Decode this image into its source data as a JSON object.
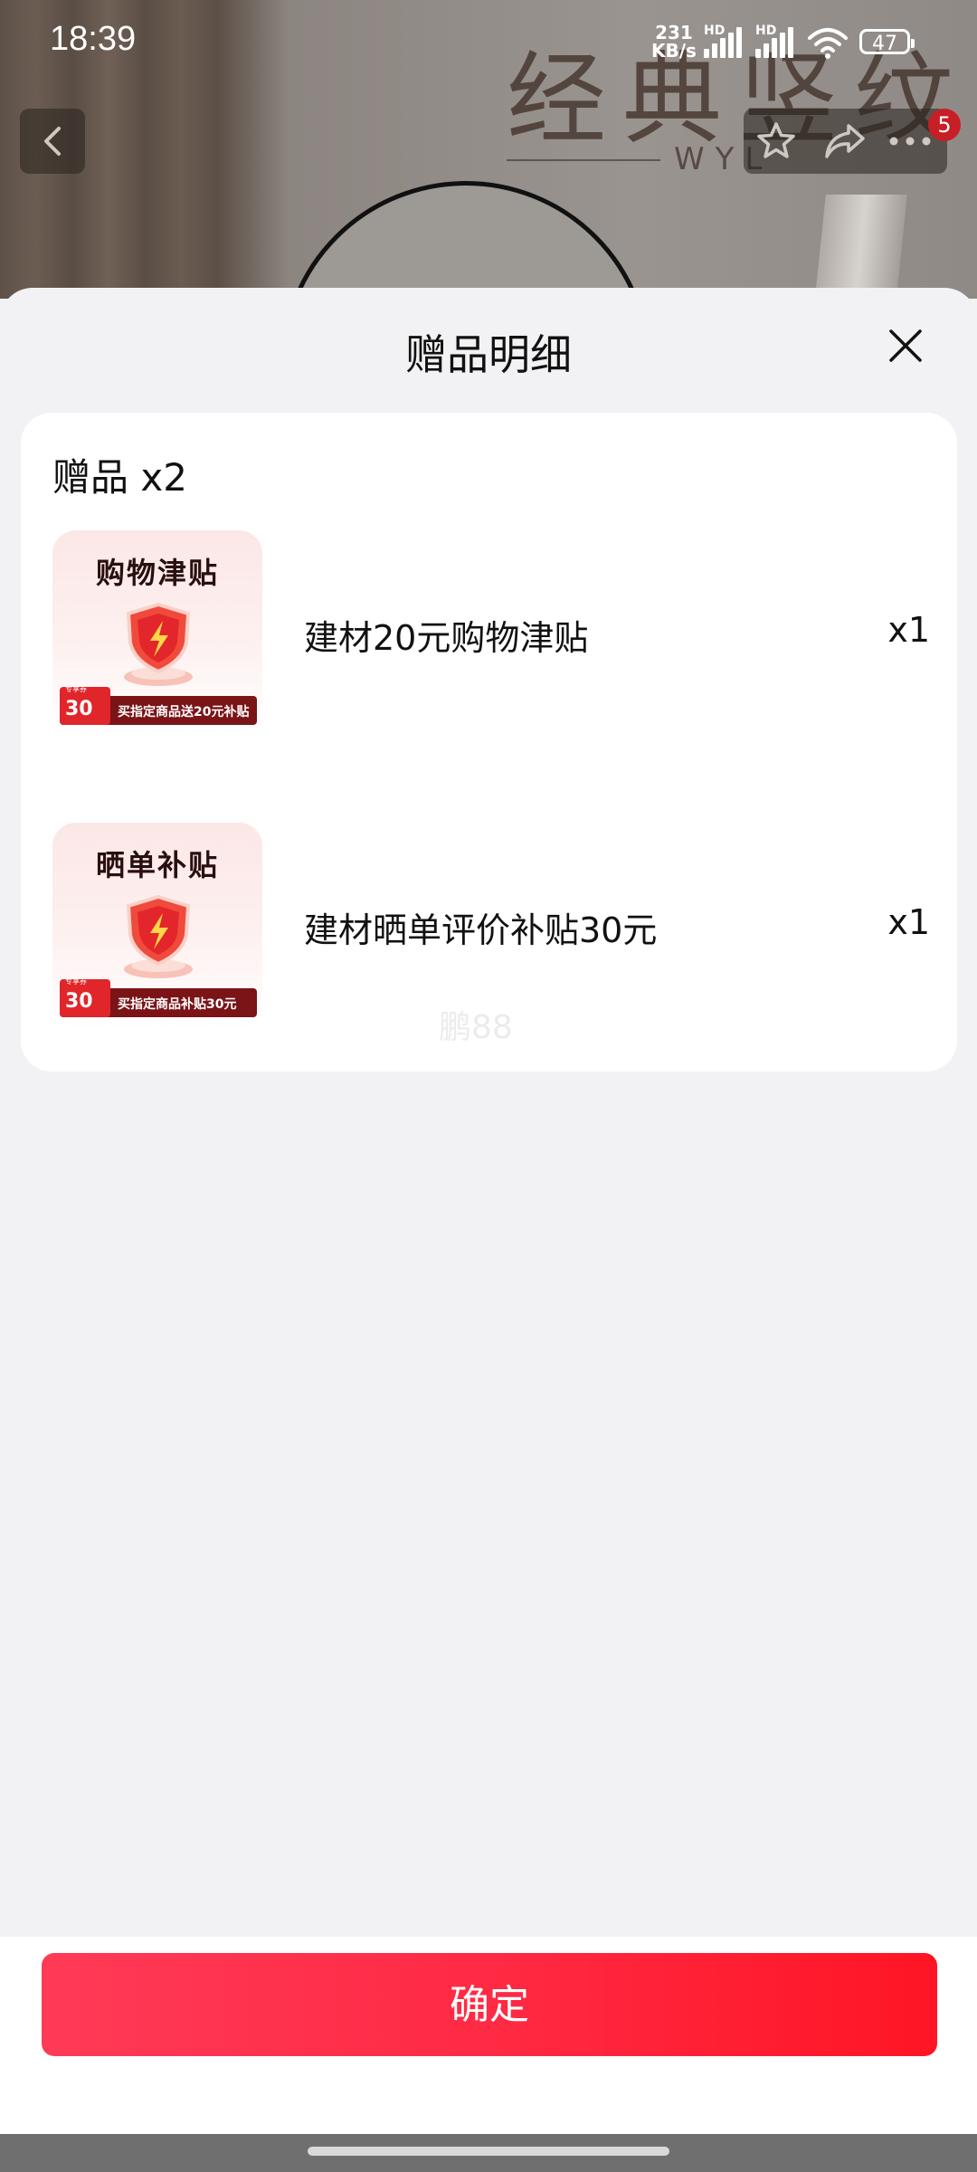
{
  "status_bar": {
    "time": "18:39",
    "network_speed_value": "231",
    "network_speed_unit": "KB/s",
    "hd_label_1": "HD",
    "hd_label_2": "HD",
    "battery": "47"
  },
  "background_page": {
    "headline": "经典竖纹",
    "subline": "WYL",
    "cart_badge": "5"
  },
  "sheet": {
    "title": "赠品明细",
    "gift_header": "赠品 x2",
    "items": [
      {
        "thumb_title": "购物津贴",
        "thumb_badge_value": "30",
        "thumb_badge_caption": "专享券",
        "thumb_footer": "买指定商品送20元补贴",
        "name": "建材20元购物津贴",
        "qty": "x1"
      },
      {
        "thumb_title": "晒单补贴",
        "thumb_badge_value": "30",
        "thumb_badge_caption": "专享券",
        "thumb_footer": "买指定商品补贴30元",
        "name": "建材晒单评价补贴30元",
        "qty": "x1"
      }
    ],
    "watermark": "鹏88"
  },
  "footer": {
    "confirm_label": "确定"
  },
  "colors": {
    "accent": "#ff2a44",
    "badge": "#c81e25"
  }
}
